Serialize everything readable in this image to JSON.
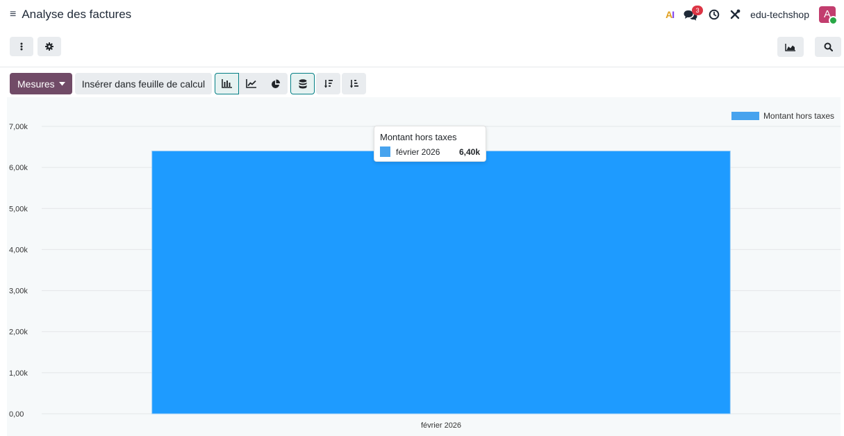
{
  "header": {
    "title": "Analyse des factures",
    "company": "edu-techshop",
    "notification_count": "3",
    "avatar_letter": "A",
    "ai_label_a": "A",
    "ai_label_i": "I"
  },
  "icons": {
    "menu": "hamburger-icon",
    "ai": "ai-icon",
    "chat": "chat-icon",
    "activity": "clock-icon",
    "debug": "tools-icon",
    "actions": "vertical-dots-icon",
    "settings": "gear-icon",
    "graph_view": "area-chart-icon",
    "search": "search-icon",
    "bar_chart": "bar-chart-icon",
    "line_chart": "line-chart-icon",
    "pie_chart": "pie-chart-icon",
    "stacked": "database-icon",
    "sort_desc": "sort-descending-icon",
    "sort_asc": "sort-ascending-icon"
  },
  "toolbar": {
    "measures_label": "Mesures",
    "insert_label": "Insérer dans feuille de calcul"
  },
  "colors": {
    "primary": "#714b67",
    "active_border": "#017e84",
    "bar": "#1e9bff",
    "legend": "#47a3ee"
  },
  "tooltip": {
    "title": "Montant hors taxes",
    "label": "février 2026",
    "value": "6,40k"
  },
  "chart_data": {
    "type": "bar",
    "categories": [
      "février 2026"
    ],
    "series": [
      {
        "name": "Montant hors taxes",
        "values": [
          6400
        ]
      }
    ],
    "ylim": [
      0,
      7000
    ],
    "yticks": [
      0,
      1000,
      2000,
      3000,
      4000,
      5000,
      6000,
      7000
    ],
    "ytick_labels": [
      "0,00",
      "1,00k",
      "2,00k",
      "3,00k",
      "4,00k",
      "5,00k",
      "6,00k",
      "7,00k"
    ],
    "legend_position": "top-right",
    "grid": true
  }
}
